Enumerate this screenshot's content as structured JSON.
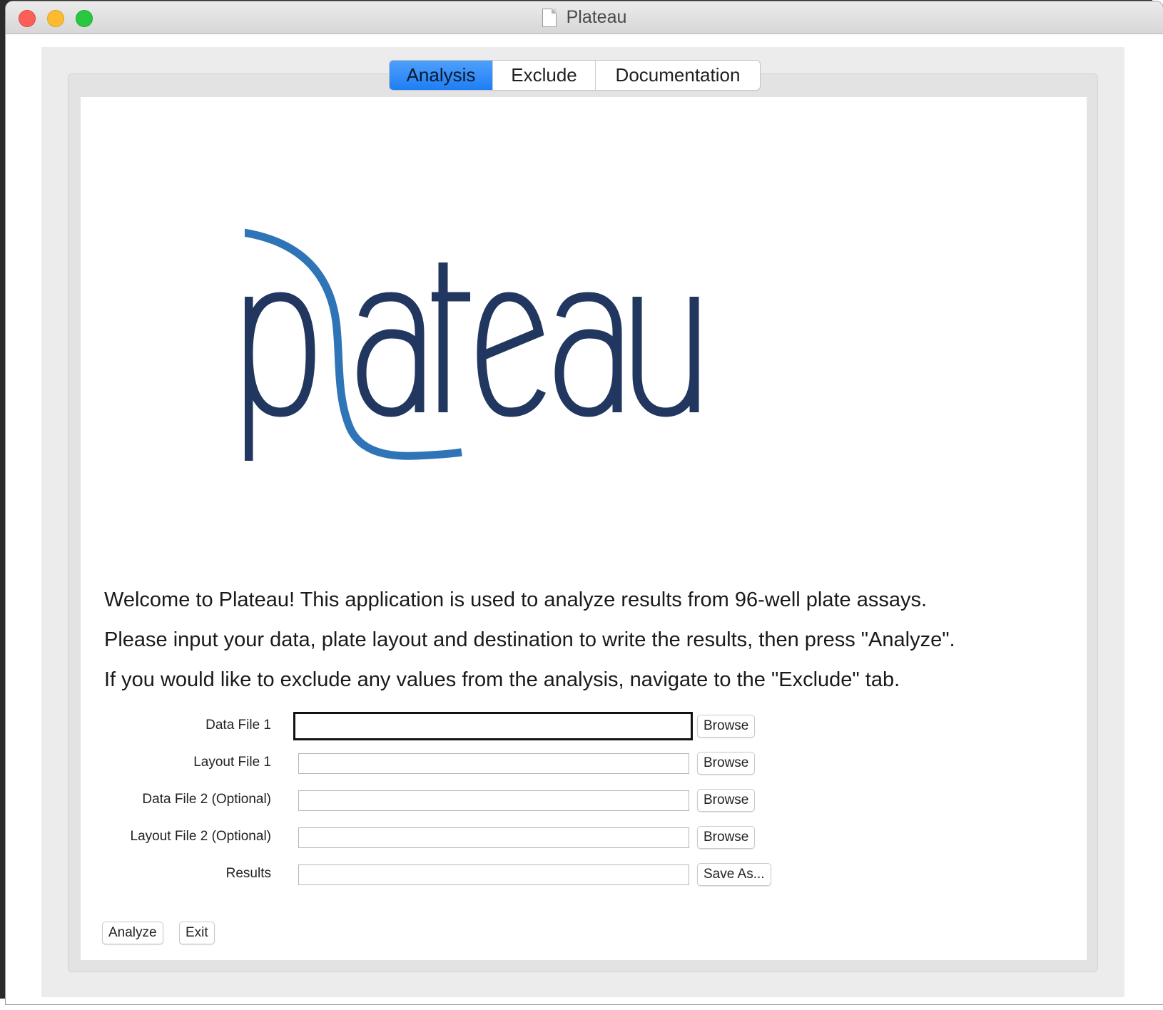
{
  "window": {
    "title": "Plateau"
  },
  "tabs": [
    {
      "label": "Analysis",
      "active": true
    },
    {
      "label": "Exclude",
      "active": false
    },
    {
      "label": "Documentation",
      "active": false
    }
  ],
  "logo": {
    "word": "plateau",
    "colors": {
      "dark": "#22375f",
      "accent": "#2f74b6"
    }
  },
  "welcome": {
    "line1": "Welcome to Plateau! This application is used to analyze results from 96-well plate assays.",
    "line2": "Please input your data, plate layout and destination to write the results, then press \"Analyze\".",
    "line3": "If you would like to exclude any values from the analysis, navigate to the \"Exclude\" tab."
  },
  "form": {
    "rows": [
      {
        "label": "Data File 1",
        "value": "",
        "button": "Browse"
      },
      {
        "label": "Layout File 1",
        "value": "",
        "button": "Browse"
      },
      {
        "label": "Data File 2 (Optional)",
        "value": "",
        "button": "Browse"
      },
      {
        "label": "Layout File 2 (Optional)",
        "value": "",
        "button": "Browse"
      },
      {
        "label": "Results",
        "value": "",
        "button": "Save As..."
      }
    ]
  },
  "actions": {
    "analyze": "Analyze",
    "exit": "Exit"
  },
  "colors": {
    "tab_active": "#2a86f7",
    "close": "#fc5f57",
    "minimize": "#fdbc2f",
    "maximize": "#29c840"
  }
}
